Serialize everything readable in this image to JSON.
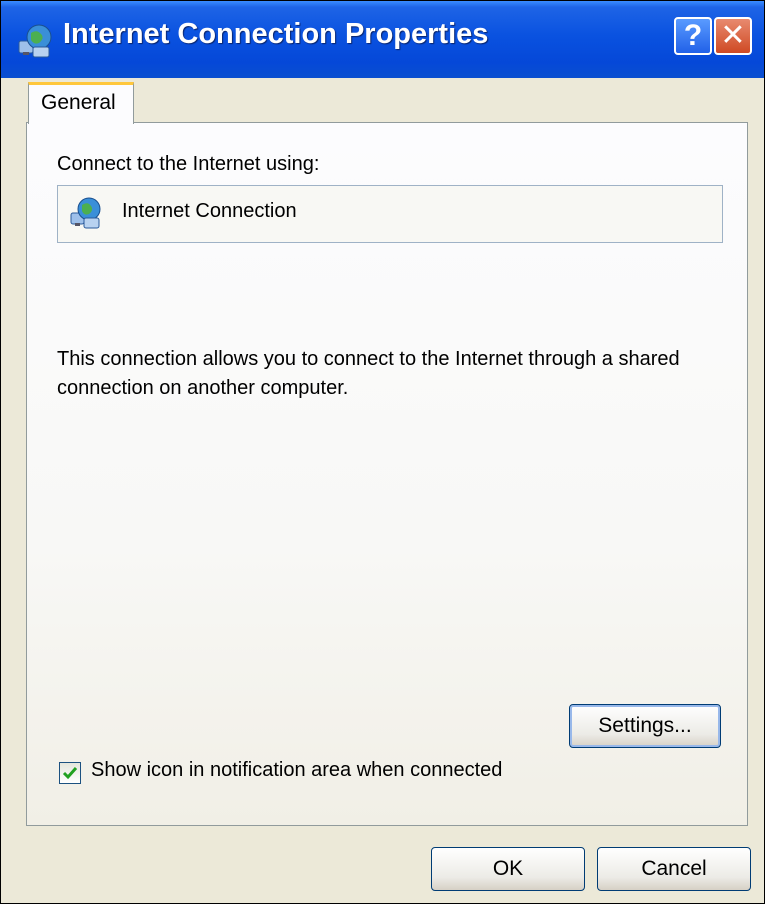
{
  "window": {
    "title": "Internet Connection Properties"
  },
  "titlebar": {
    "help_label": "?",
    "close_label": "✕"
  },
  "tabs": [
    {
      "label": "General"
    }
  ],
  "general": {
    "connect_label": "Connect to the Internet using:",
    "connection_name": "Internet Connection",
    "description": "This connection allows you to connect to the Internet through a shared connection on another computer.",
    "settings_label": "Settings...",
    "show_icon_label": "Show icon in notification area when connected",
    "show_icon_checked": true
  },
  "footer": {
    "ok_label": "OK",
    "cancel_label": "Cancel"
  },
  "colors": {
    "titlebar": "#0a52e0",
    "dialog_bg": "#ece9d8",
    "tab_highlight": "#ffc73c",
    "checkmark": "#21a121"
  },
  "icons": {
    "title": "network-globe-icon",
    "connection": "network-globe-icon",
    "help": "help-icon",
    "close": "close-icon",
    "check": "checkmark-icon"
  }
}
